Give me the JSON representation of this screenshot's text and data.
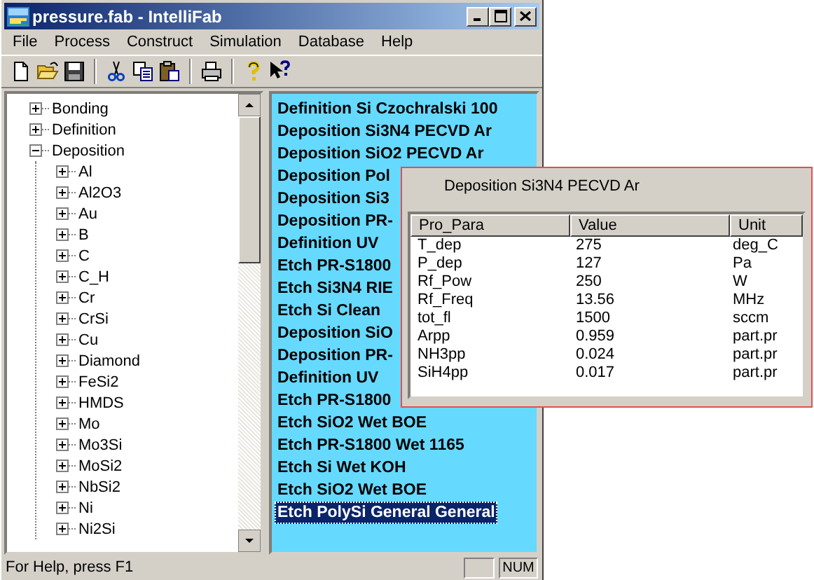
{
  "window": {
    "title": "pressure.fab - IntelliFab"
  },
  "menu": [
    "File",
    "Process",
    "Construct",
    "Simulation",
    "Database",
    "Help"
  ],
  "toolbar": [
    {
      "kind": "new"
    },
    {
      "kind": "open"
    },
    {
      "kind": "save"
    },
    {
      "kind": "sep"
    },
    {
      "kind": "cut"
    },
    {
      "kind": "copy"
    },
    {
      "kind": "paste"
    },
    {
      "kind": "sep"
    },
    {
      "kind": "print"
    },
    {
      "kind": "sep"
    },
    {
      "kind": "help"
    },
    {
      "kind": "context-help"
    }
  ],
  "tree": [
    {
      "label": "Bonding",
      "expanded": false
    },
    {
      "label": "Definition",
      "expanded": false
    },
    {
      "label": "Deposition",
      "expanded": true,
      "children": [
        {
          "label": "Al",
          "expanded": false
        },
        {
          "label": "Al2O3",
          "expanded": false
        },
        {
          "label": "Au",
          "expanded": false
        },
        {
          "label": "B",
          "expanded": false
        },
        {
          "label": "C",
          "expanded": false
        },
        {
          "label": "C_H",
          "expanded": false
        },
        {
          "label": "Cr",
          "expanded": false
        },
        {
          "label": "CrSi",
          "expanded": false
        },
        {
          "label": "Cu",
          "expanded": false
        },
        {
          "label": "Diamond",
          "expanded": false
        },
        {
          "label": "FeSi2",
          "expanded": false
        },
        {
          "label": "HMDS",
          "expanded": false
        },
        {
          "label": "Mo",
          "expanded": false
        },
        {
          "label": "Mo3Si",
          "expanded": false
        },
        {
          "label": "MoSi2",
          "expanded": false
        },
        {
          "label": "NbSi2",
          "expanded": false
        },
        {
          "label": "Ni",
          "expanded": false
        },
        {
          "label": "Ni2Si",
          "expanded": false
        }
      ]
    }
  ],
  "process_list": [
    {
      "label": "Definition Si Czochralski 100",
      "selected": false
    },
    {
      "label": "Deposition Si3N4 PECVD Ar",
      "selected": false
    },
    {
      "label": "Deposition SiO2 PECVD Ar",
      "selected": false
    },
    {
      "label": "Deposition Pol",
      "selected": false
    },
    {
      "label": "Deposition Si3",
      "selected": false
    },
    {
      "label": "Deposition PR-",
      "selected": false
    },
    {
      "label": "Definition UV",
      "selected": false
    },
    {
      "label": "Etch PR-S1800",
      "selected": false
    },
    {
      "label": "Etch Si3N4 RIE",
      "selected": false
    },
    {
      "label": "Etch Si Clean",
      "selected": false
    },
    {
      "label": "Deposition SiO",
      "selected": false
    },
    {
      "label": "Deposition PR-",
      "selected": false
    },
    {
      "label": "Definition UV",
      "selected": false
    },
    {
      "label": "Etch PR-S1800",
      "selected": false
    },
    {
      "label": "Etch SiO2 Wet BOE",
      "selected": false
    },
    {
      "label": "Etch PR-S1800 Wet 1165",
      "selected": false
    },
    {
      "label": "Etch Si Wet KOH",
      "selected": false
    },
    {
      "label": "Etch SiO2 Wet BOE",
      "selected": false
    },
    {
      "label": "Etch PolySi General General",
      "selected": true
    }
  ],
  "popup": {
    "title": "Deposition Si3N4 PECVD Ar",
    "table": {
      "columns": [
        "Pro_Para",
        "Value",
        "Unit"
      ],
      "rows": [
        [
          "T_dep",
          "275",
          "deg_C"
        ],
        [
          "P_dep",
          "127",
          "Pa"
        ],
        [
          "Rf_Pow",
          "250",
          "W"
        ],
        [
          "Rf_Freq",
          "13.56",
          "MHz"
        ],
        [
          "tot_fl",
          "1500",
          "sccm"
        ],
        [
          "Arpp",
          "0.959",
          "part.pr"
        ],
        [
          "NH3pp",
          "0.024",
          "part.pr"
        ],
        [
          "SiH4pp",
          "0.017",
          "part.pr"
        ]
      ]
    }
  },
  "status_bar": {
    "text": "For Help, press F1",
    "num_indicator": "NUM"
  }
}
